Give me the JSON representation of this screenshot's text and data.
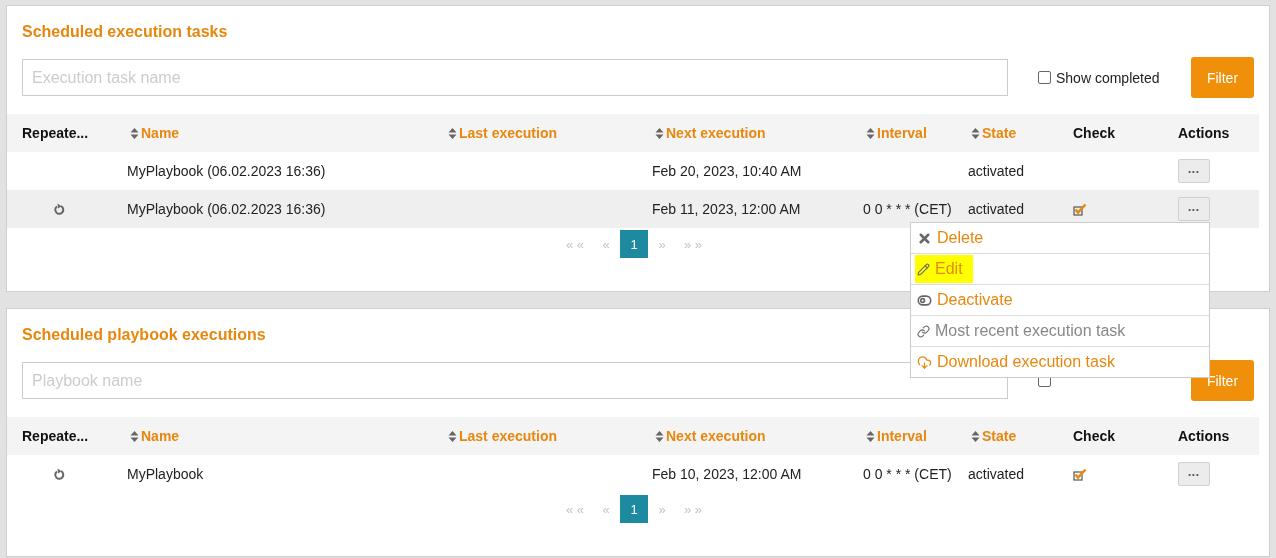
{
  "panels": [
    {
      "title": "Scheduled execution tasks",
      "search": {
        "placeholder": "Execution task name"
      },
      "show_completed": {
        "label": "Show completed",
        "checked": false
      },
      "filter_button": "Filter",
      "columns": [
        {
          "label": "Repeate...",
          "sortable": false
        },
        {
          "label": "Name",
          "sortable": true
        },
        {
          "label": "Last execution",
          "sortable": true
        },
        {
          "label": "Next execution",
          "sortable": true
        },
        {
          "label": "Interval",
          "sortable": true
        },
        {
          "label": "State",
          "sortable": true
        },
        {
          "label": "Check",
          "sortable": false
        },
        {
          "label": "Actions",
          "sortable": false
        }
      ],
      "rows": [
        {
          "repeated": false,
          "name": "MyPlaybook (06.02.2023 16:36)",
          "last_execution": "",
          "next_execution": "Feb 20, 2023, 10:40 AM",
          "interval": "",
          "state": "activated",
          "checked": false,
          "highlighted": false,
          "actions_button": "•••",
          "menu_open": false
        },
        {
          "repeated": true,
          "name": "MyPlaybook (06.02.2023 16:36)",
          "last_execution": "",
          "next_execution": "Feb 11, 2023, 12:00 AM",
          "interval": "0 0 * * * (CET)",
          "state": "activated",
          "checked": true,
          "highlighted": true,
          "actions_button": "•••",
          "menu_open": true
        }
      ],
      "pagination": [
        {
          "label": "« «",
          "selected": false
        },
        {
          "label": "«",
          "selected": false
        },
        {
          "label": "1",
          "selected": true
        },
        {
          "label": "»",
          "selected": false
        },
        {
          "label": "» »",
          "selected": false
        }
      ]
    },
    {
      "title": "Scheduled playbook executions",
      "search": {
        "placeholder": "Playbook name"
      },
      "show_completed": {
        "checked": false
      },
      "filter_button": "Filter",
      "columns": [
        {
          "label": "Repeate...",
          "sortable": false
        },
        {
          "label": "Name",
          "sortable": true
        },
        {
          "label": "Last execution",
          "sortable": true
        },
        {
          "label": "Next execution",
          "sortable": true
        },
        {
          "label": "Interval",
          "sortable": true
        },
        {
          "label": "State",
          "sortable": true
        },
        {
          "label": "Check",
          "sortable": false
        },
        {
          "label": "Actions",
          "sortable": false
        }
      ],
      "rows": [
        {
          "repeated": true,
          "name": "MyPlaybook",
          "last_execution": "",
          "next_execution": "Feb 10, 2023, 12:00 AM",
          "interval": "0 0 * * * (CET)",
          "state": "activated",
          "checked": true,
          "highlighted": false,
          "actions_button": "•••",
          "menu_open": false
        }
      ],
      "pagination": [
        {
          "label": "« «",
          "selected": false
        },
        {
          "label": "«",
          "selected": false
        },
        {
          "label": "1",
          "selected": true
        },
        {
          "label": "»",
          "selected": false
        },
        {
          "label": "» »",
          "selected": false
        }
      ]
    }
  ],
  "actions_menu": [
    {
      "kind": "delete",
      "label": "Delete",
      "disabled": false,
      "highlighted": false
    },
    {
      "kind": "edit",
      "label": "Edit",
      "disabled": false,
      "highlighted": true
    },
    {
      "kind": "deactivate",
      "label": "Deactivate",
      "disabled": false,
      "highlighted": false
    },
    {
      "kind": "link",
      "label": "Most recent execution task",
      "disabled": true,
      "highlighted": false
    },
    {
      "kind": "download",
      "label": "Download execution task",
      "disabled": false,
      "highlighted": false
    }
  ]
}
